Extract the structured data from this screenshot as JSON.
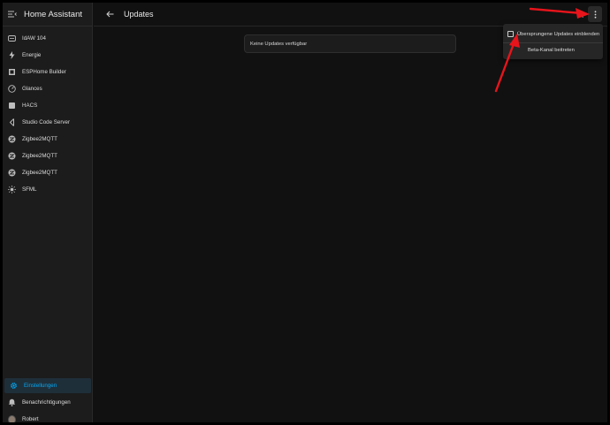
{
  "app": {
    "title": "Home Assistant"
  },
  "sidebar": {
    "items": [
      {
        "label": "IdAW 104",
        "icon": "grid-icon"
      },
      {
        "label": "Energie",
        "icon": "lightning-icon"
      },
      {
        "label": "ESPHome Builder",
        "icon": "esphome-icon"
      },
      {
        "label": "Glances",
        "icon": "gauge-icon"
      },
      {
        "label": "HACS",
        "icon": "hacs-icon"
      },
      {
        "label": "Studio Code Server",
        "icon": "code-icon"
      },
      {
        "label": "Zigbee2MQTT",
        "icon": "zigbee-icon"
      },
      {
        "label": "Zigbee2MQTT",
        "icon": "zigbee-icon"
      },
      {
        "label": "Zigbee2MQTT",
        "icon": "zigbee-icon"
      },
      {
        "label": "SFML",
        "icon": "sun-icon"
      }
    ],
    "bottom": [
      {
        "label": "Einstellungen",
        "icon": "gear-icon",
        "active": true
      },
      {
        "label": "Benachrichtigungen",
        "icon": "bell-icon"
      },
      {
        "label": "Robert",
        "icon": "avatar"
      }
    ]
  },
  "header": {
    "title": "Updates"
  },
  "main": {
    "empty_text": "Keine Updates verfügbar"
  },
  "menu": {
    "show_skipped_label": "Übersprungene Updates einblenden",
    "show_skipped_checked": false,
    "beta_label": "Beta-Kanal beitreten"
  },
  "colors": {
    "accent": "#03a9f4",
    "annotation": "#e8141b"
  }
}
